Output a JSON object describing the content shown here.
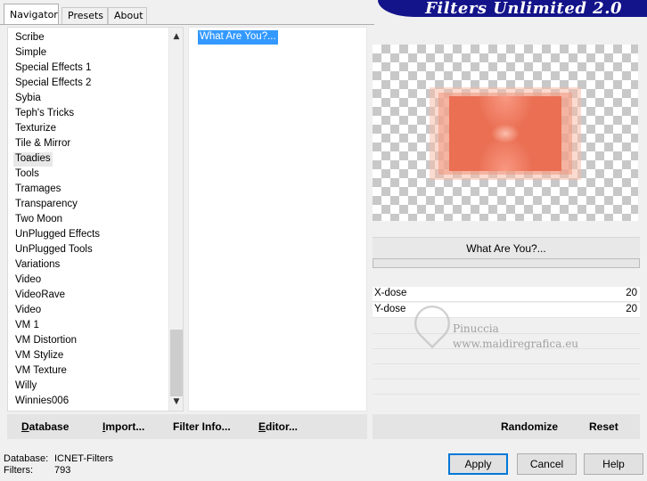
{
  "tabs": [
    {
      "label": "Navigator",
      "active": true
    },
    {
      "label": "Presets",
      "active": false
    },
    {
      "label": "About",
      "active": false
    }
  ],
  "banner": {
    "title": "Filters Unlimited 2.0"
  },
  "categories": {
    "items": [
      "Scribe",
      "Simple",
      "Special Effects 1",
      "Special Effects 2",
      "Sybia",
      "Teph's Tricks",
      "Texturize",
      "Tile & Mirror",
      "Toadies",
      "Tools",
      "Tramages",
      "Transparency",
      "Two Moon",
      "UnPlugged Effects",
      "UnPlugged Tools",
      "Variations",
      "Video",
      "VideoRave",
      "Video",
      "VM 1",
      "VM Distortion",
      "VM Stylize",
      "VM Texture",
      "Willy",
      "Winnies006"
    ],
    "selected": "Toadies",
    "scroll_up_icon": "▲",
    "scroll_down_icon": "▼"
  },
  "filters": {
    "items": [
      "What Are You?..."
    ],
    "selected": "What Are You?..."
  },
  "preview": {
    "filter_name": "What Are You?...",
    "art_color": "#ea6f53"
  },
  "params": [
    {
      "name": "X-dose",
      "value": "20"
    },
    {
      "name": "Y-dose",
      "value": "20"
    }
  ],
  "watermark": {
    "name": "Pinuccia",
    "site": "www.maidiregrafica.eu"
  },
  "left_buttons": [
    {
      "label": "Database",
      "underline": "D",
      "rest": "atabase"
    },
    {
      "label": "Import...",
      "underline": "I",
      "rest": "mport..."
    },
    {
      "label": "Filter Info...",
      "underline": "",
      "rest": "Filter Info..."
    },
    {
      "label": "Editor...",
      "underline": "E",
      "rest": "ditor..."
    }
  ],
  "right_buttons": {
    "randomize": "Randomize",
    "reset": "Reset"
  },
  "status": {
    "database_label": "Database:",
    "database_value": "ICNET-Filters",
    "filters_label": "Filters:",
    "filters_value": "793"
  },
  "dialog_buttons": {
    "apply": "Apply",
    "cancel": "Cancel",
    "help": "Help"
  }
}
